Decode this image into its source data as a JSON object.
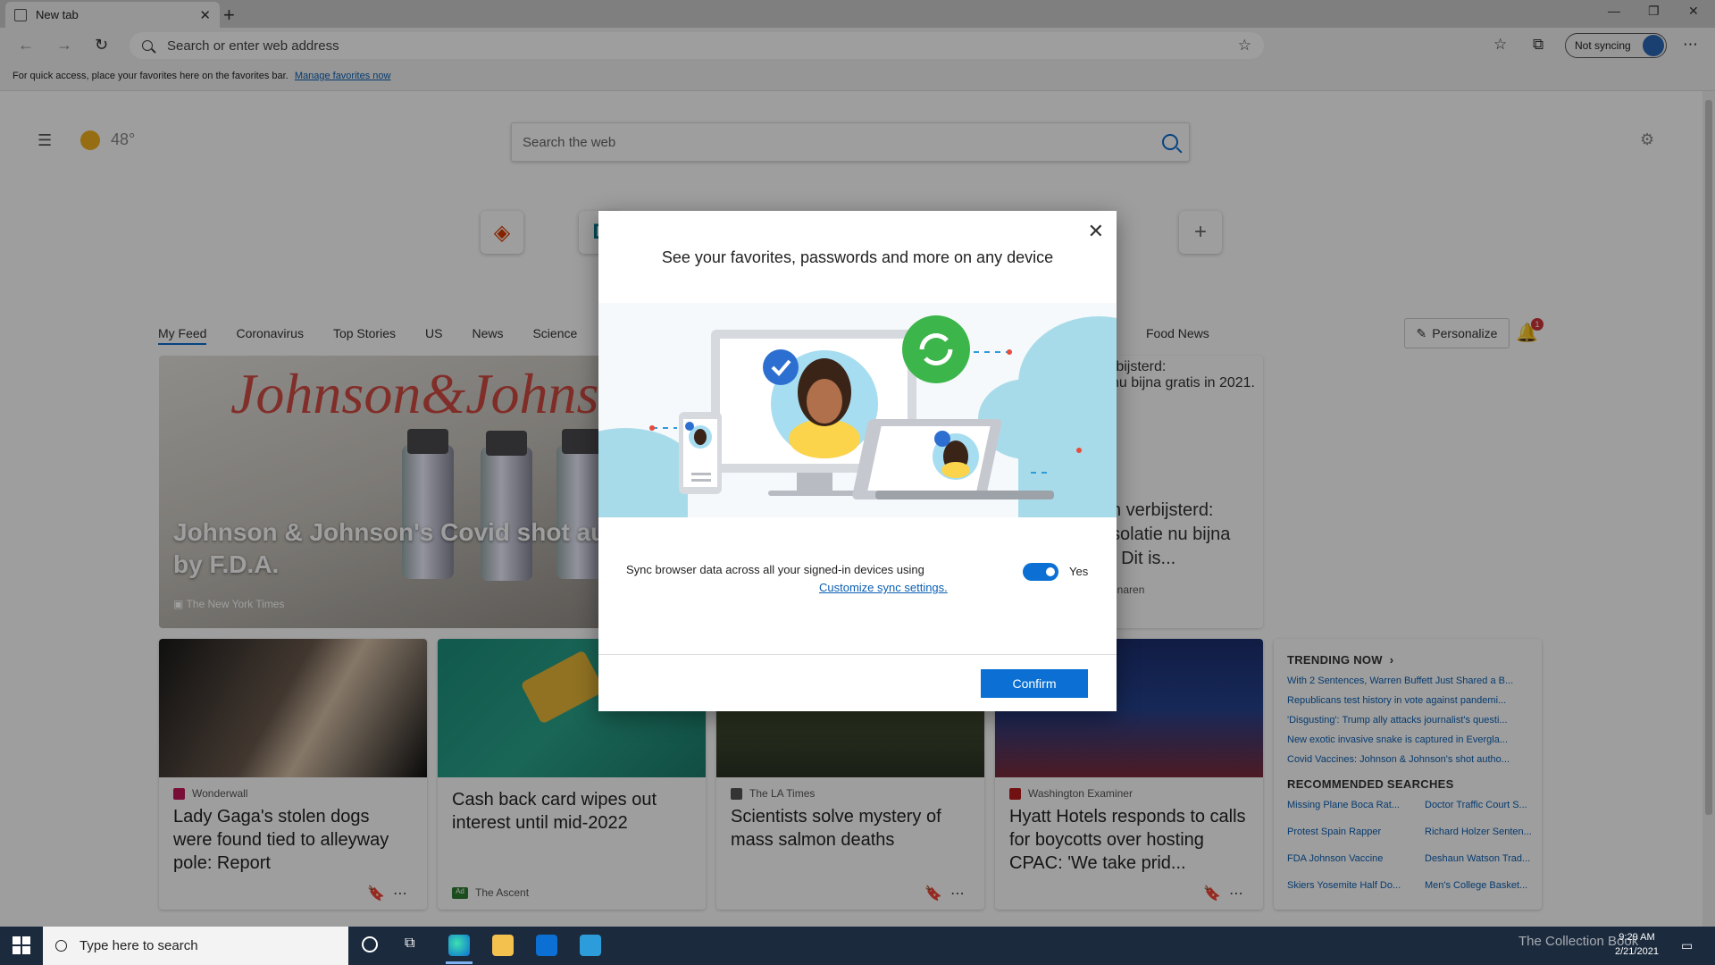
{
  "browser": {
    "tab_title": "New tab",
    "address_placeholder": "Search or enter web address",
    "sync_button": "Not syncing",
    "favorites_bar_text": "For quick access, place your favorites here on the favorites bar.",
    "favorites_bar_link": "Manage favorites now"
  },
  "newtab": {
    "weather_temp": "48°",
    "search_placeholder": "Search the web",
    "feed_tabs": [
      "My Feed",
      "Coronavirus",
      "Top Stories",
      "US",
      "News",
      "Science"
    ],
    "feed_tab_right": "Food News",
    "personalize": "Personalize",
    "notification_count": "1",
    "hero": {
      "headline": "Johnson & Johnson's Covid shot autho… by F.D.A.",
      "source": "The New York Times",
      "brand_text": "Johnson&Johnson"
    },
    "hero_right": {
      "text1": "rbijsterd:",
      "text2": "nu bijna gratis in 2021.",
      "headline": "n verbijsterd: solatie nu bijna . Dit is...",
      "source": "enaren"
    },
    "cards": [
      {
        "source": "Wonderwall",
        "title": "Lady Gaga's stolen dogs were found tied to alleyway pole: Report"
      },
      {
        "source": "The Ascent",
        "ad": "Ad",
        "title": "Cash back card wipes out interest until mid-2022"
      },
      {
        "source": "The LA Times",
        "title": "Scientists solve mystery of mass salmon deaths"
      },
      {
        "source": "Washington Examiner",
        "title": "Hyatt Hotels responds to calls for boycotts over hosting CPAC: 'We take prid..."
      }
    ],
    "trending": {
      "title": "TRENDING NOW",
      "items": [
        "With 2 Sentences, Warren Buffett Just Shared a B...",
        "Republicans test history in vote against pandemi...",
        "'Disgusting': Trump ally attacks journalist's questi...",
        "New exotic invasive snake is captured in Evergla...",
        "Covid Vaccines: Johnson & Johnson's shot autho..."
      ],
      "recommended_title": "RECOMMENDED SEARCHES",
      "recommended": [
        "Missing Plane Boca Rat...",
        "Doctor Traffic Court S...",
        "Protest Spain Rapper",
        "Richard Holzer Senten...",
        "FDA Johnson Vaccine",
        "Deshaun Watson Trad...",
        "Skiers Yosemite Half Do...",
        "Men's College Basket..."
      ]
    }
  },
  "dialog": {
    "title": "See your favorites, passwords and more on any device",
    "sync_text": "Sync browser data across all your signed-in devices using",
    "customize_link": "Customize sync settings.",
    "toggle_label": "Yes",
    "toggle_on": true,
    "confirm": "Confirm"
  },
  "taskbar": {
    "search_placeholder": "Type here to search",
    "time": "9:29 AM",
    "date": "2/21/2021",
    "watermark": "The Collection Book"
  },
  "colors": {
    "accent": "#0b6fd3",
    "link": "#0b5fb3",
    "taskbar": "#1b2a3d"
  }
}
